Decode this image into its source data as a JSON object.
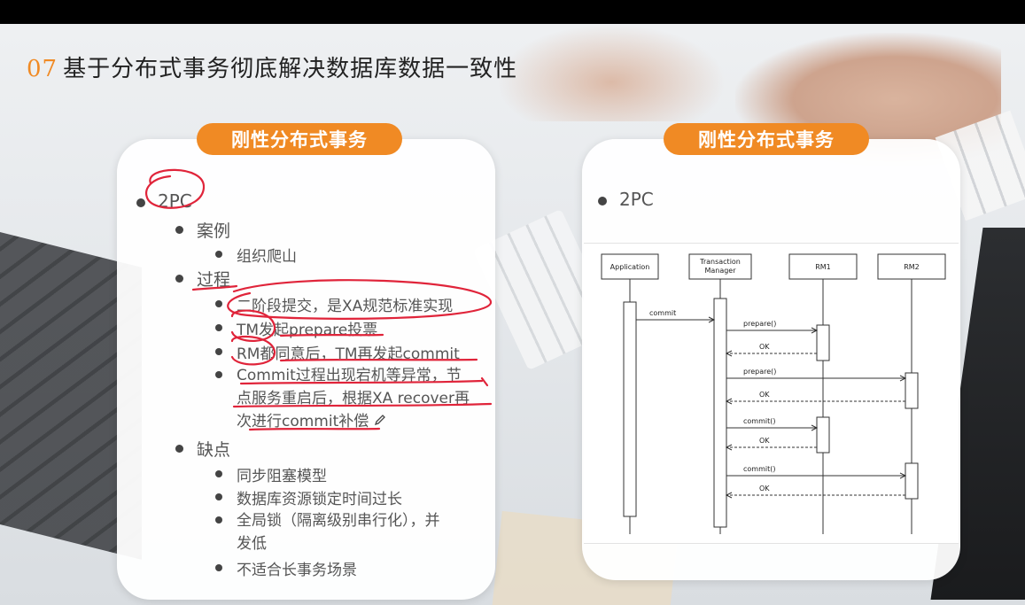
{
  "slide": {
    "number": "07",
    "title": "基于分布式事务彻底解决数据库数据一致性"
  },
  "left_card": {
    "header": "刚性分布式事务",
    "items": {
      "l1": "2PC",
      "case_label": "案例",
      "case_item": "组织爬山",
      "process_label": "过程",
      "process_1": "二阶段提交，是XA规范标准实现",
      "process_2": "TM发起prepare投票",
      "process_3": "RM都同意后，TM再发起commit",
      "process_4_line1": "Commit过程出现宕机等异常，节",
      "process_4_line2": "点服务重启后，根据XA recover再",
      "process_4_line3": "次进行commit补偿",
      "cons_label": "缺点",
      "cons_1": "同步阻塞模型",
      "cons_2": "数据库资源锁定时间过长",
      "cons_3_line1": "全局锁（隔离级别串行化），并",
      "cons_3_line2": "发低",
      "cons_4": "不适合长事务场景"
    }
  },
  "right_card": {
    "header": "刚性分布式事务",
    "l1": "2PC"
  },
  "diagram": {
    "participants": [
      "Application",
      "Transaction Manager",
      "RM1",
      "RM2"
    ],
    "participant_label_tm_line1": "Transaction",
    "participant_label_tm_line2": "Manager",
    "messages": [
      {
        "from": "Application",
        "to": "Transaction Manager",
        "label": "commit",
        "kind": "call"
      },
      {
        "from": "Transaction Manager",
        "to": "RM1",
        "label": "prepare()",
        "kind": "call"
      },
      {
        "from": "RM1",
        "to": "Transaction Manager",
        "label": "OK",
        "kind": "return"
      },
      {
        "from": "Transaction Manager",
        "to": "RM2",
        "label": "prepare()",
        "kind": "call"
      },
      {
        "from": "RM2",
        "to": "Transaction Manager",
        "label": "OK",
        "kind": "return"
      },
      {
        "from": "Transaction Manager",
        "to": "RM1",
        "label": "commit()",
        "kind": "call"
      },
      {
        "from": "RM1",
        "to": "Transaction Manager",
        "label": "OK",
        "kind": "return"
      },
      {
        "from": "Transaction Manager",
        "to": "RM2",
        "label": "commit()",
        "kind": "call"
      },
      {
        "from": "RM2",
        "to": "Transaction Manager",
        "label": "OK",
        "kind": "return"
      }
    ]
  },
  "colors": {
    "accent": "#f08a24",
    "ink_annotation": "#e0243a",
    "title_text": "#222222",
    "body_text": "#555555"
  },
  "icons": {
    "pencil": "pencil-icon"
  }
}
